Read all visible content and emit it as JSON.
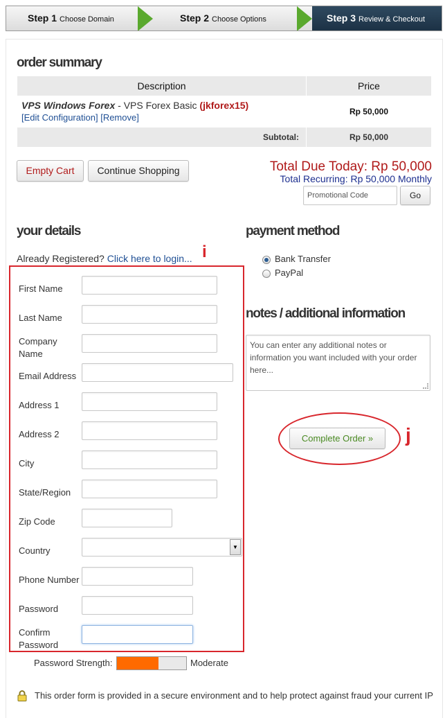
{
  "steps": [
    {
      "number": "Step 1",
      "label": "Choose Domain"
    },
    {
      "number": "Step 2",
      "label": "Choose Options"
    },
    {
      "number": "Step 3",
      "label": "Review & Checkout"
    }
  ],
  "order_summary": {
    "title": "order summary",
    "columns": {
      "description": "Description",
      "price": "Price"
    },
    "item": {
      "product_group": "VPS Windows Forex",
      "separator": " - ",
      "product_name": "VPS Forex Basic",
      "domain": "(jkforex15)",
      "edit_link": "[Edit Configuration]",
      "remove_link": "[Remove]",
      "price": "Rp 50,000"
    },
    "subtotal_label": "Subtotal:",
    "subtotal_value": "Rp 50,000"
  },
  "actions": {
    "empty_cart": "Empty Cart",
    "continue_shopping": "Continue Shopping"
  },
  "totals": {
    "due_today": "Total Due Today: Rp 50,000",
    "recurring": "Total Recurring: Rp 50,000 Monthly"
  },
  "promo": {
    "placeholder": "Promotional Code",
    "button": "Go"
  },
  "details": {
    "title": "your details",
    "already_registered": "Already Registered?",
    "login_link": "Click here to login...",
    "fields": {
      "first_name": "First Name",
      "last_name": "Last Name",
      "company_name": "Company Name",
      "email": "Email Address",
      "address1": "Address 1",
      "address2": "Address 2",
      "city": "City",
      "state": "State/Region",
      "zip": "Zip Code",
      "country": "Country",
      "phone": "Phone Number",
      "password": "Password",
      "confirm_password": "Confirm Password"
    },
    "password_strength_label": "Password Strength:",
    "password_strength_value": "Moderate",
    "password_strength_level": 0.6
  },
  "payment": {
    "title": "payment method",
    "options": [
      "Bank Transfer",
      "PayPal"
    ],
    "selected": "Bank Transfer"
  },
  "notes": {
    "title": "notes / additional information",
    "placeholder": "You can enter any additional notes or information you want included with your order here..."
  },
  "complete_order": "Complete Order »",
  "secure_notice": "This order form is provided in a secure environment and to help protect against fraud your current IP",
  "annotations": {
    "i": "i",
    "j": "j"
  },
  "colors": {
    "accent_red": "#b01a1a",
    "link_blue": "#1f4f94",
    "step_green": "#5aa92e",
    "active_step": "#1c3145",
    "annotation_red": "#d8262c",
    "strength_orange": "#ff6a00"
  }
}
